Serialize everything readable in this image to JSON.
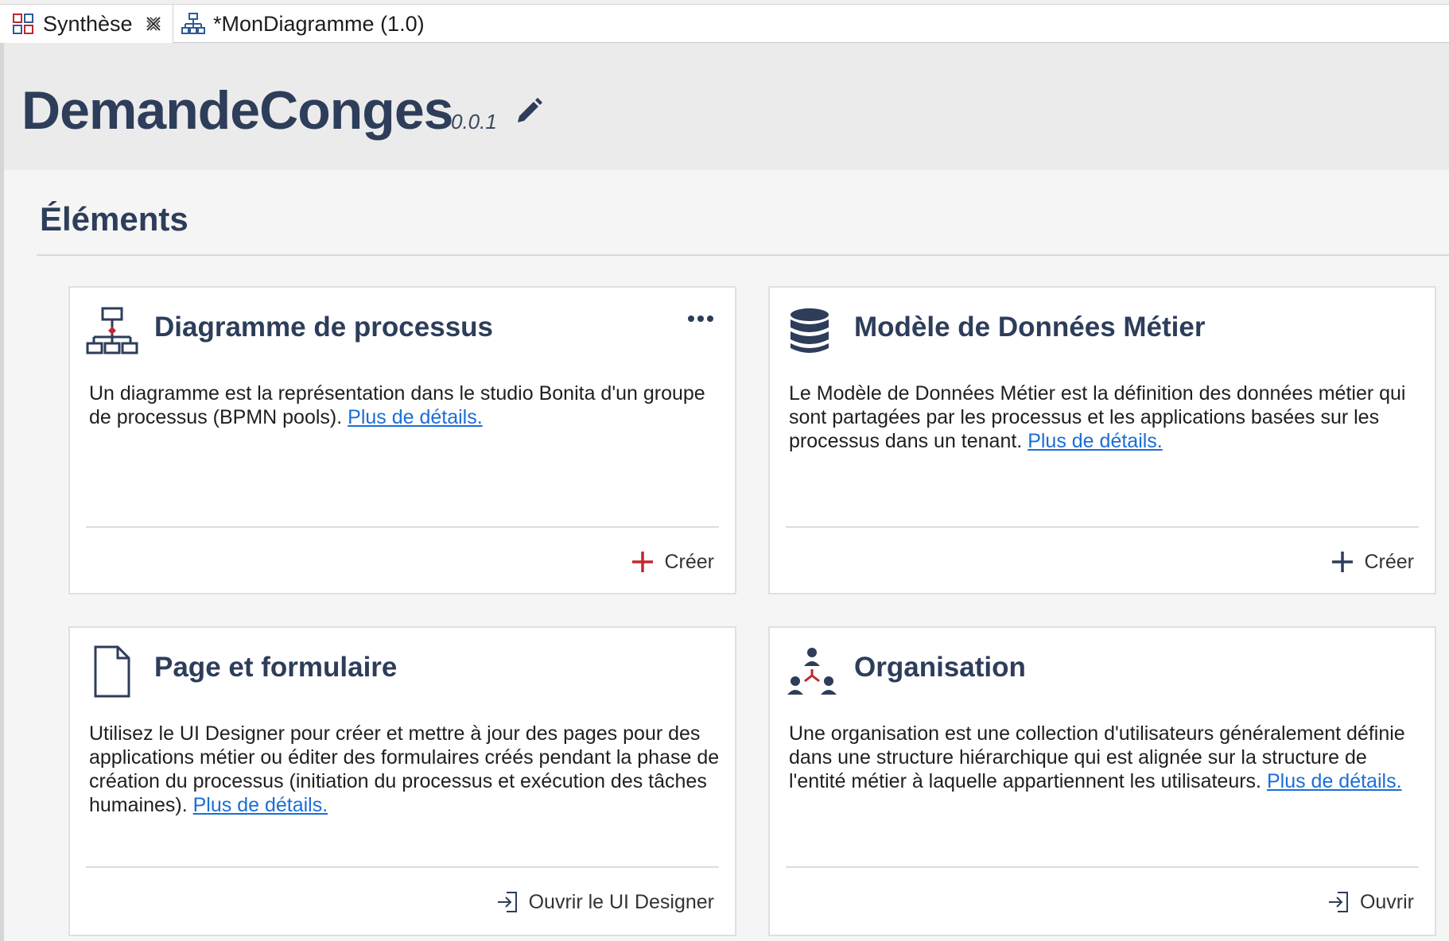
{
  "tabs": [
    {
      "label": "Synthèse",
      "icon": "overview-icon",
      "closable": true
    },
    {
      "label": "*MonDiagramme (1.0)",
      "icon": "diagram-icon",
      "closable": false
    }
  ],
  "header": {
    "title": "DemandeConges",
    "version": "0.0.1",
    "edit_icon": "pencil-icon"
  },
  "section": {
    "title": "Éléments"
  },
  "cards": [
    {
      "title": "Diagramme de processus",
      "icon": "process-diagram-icon",
      "description": "Un diagramme est la représentation dans le studio Bonita d'un groupe de processus (BPMN pools).",
      "link": "Plus de détails.",
      "action": "Créer",
      "action_icon": "plus-icon",
      "has_menu": true
    },
    {
      "title": "Modèle de Données Métier",
      "icon": "database-icon",
      "description": "Le Modèle de Données Métier est la définition des données métier qui sont partagées par les processus et les applications basées sur les processus dans un tenant.",
      "link": "Plus de détails.",
      "action": "Créer",
      "action_icon": "plus-icon"
    },
    {
      "title": "Page et formulaire",
      "icon": "page-icon",
      "description": "Utilisez le UI Designer pour créer et mettre à jour des pages pour des applications métier ou éditer des formulaires créés pendant la phase de création du processus (initiation du processus et exécution des tâches humaines).",
      "link": "Plus de détails.",
      "action": "Ouvrir le UI Designer",
      "action_icon": "open-icon"
    },
    {
      "title": "Organisation",
      "icon": "organization-icon",
      "description": "Une organisation est une collection d'utilisateurs généralement définie dans une structure hiérarchique qui est alignée sur la structure de l'entité métier à laquelle appartiennent les utilisateurs.",
      "link": "Plus de détails.",
      "action": "Ouvrir",
      "action_icon": "open-icon"
    }
  ],
  "colors": {
    "title": "#2d3d5a",
    "link": "#1a6ed8",
    "accent_red": "#c0282d",
    "header_bg": "#ebebeb",
    "page_bg": "#f5f5f5"
  }
}
